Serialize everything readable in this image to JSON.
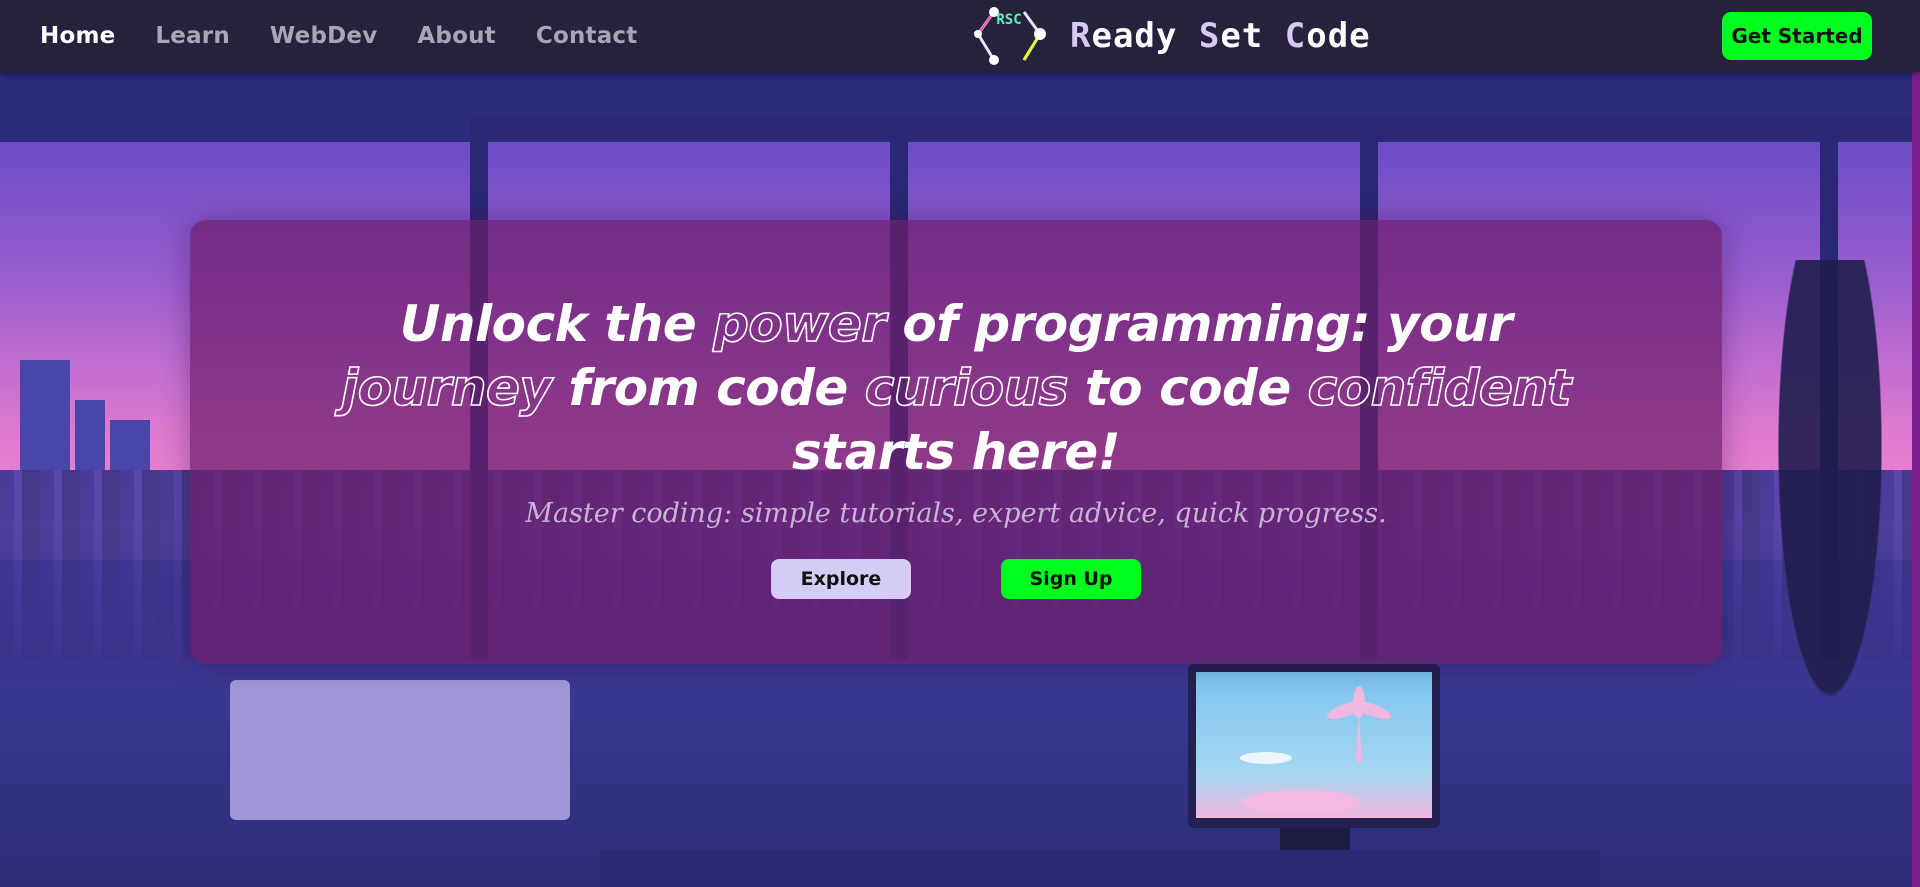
{
  "nav": {
    "links": [
      "Home",
      "Learn",
      "WebDev",
      "About",
      "Contact"
    ],
    "active": "Home"
  },
  "brand": {
    "logo_letters": "RSC",
    "name_parts": [
      "R",
      "eady ",
      "S",
      "et ",
      "C",
      "ode"
    ]
  },
  "header": {
    "cta_label": "Get Started"
  },
  "hero": {
    "title_parts": [
      {
        "text": "Unlock the ",
        "outline": false
      },
      {
        "text": "power",
        "outline": true
      },
      {
        "text": " of programming: your ",
        "outline": false
      },
      {
        "text": "journey",
        "outline": true
      },
      {
        "text": " from code ",
        "outline": false
      },
      {
        "text": "curious",
        "outline": true
      },
      {
        "text": " to code ",
        "outline": false
      },
      {
        "text": "confident",
        "outline": true
      },
      {
        "text": " starts here!",
        "outline": false
      }
    ],
    "subtitle": "Master coding: simple tutorials, expert advice, quick progress.",
    "explore_label": "Explore",
    "signup_label": "Sign Up"
  },
  "colors": {
    "accent_green": "#00ff1e",
    "navbar_bg": "#24223c",
    "hero_bg": "#6e1e6e",
    "explore_bg": "#d4ccf4"
  }
}
